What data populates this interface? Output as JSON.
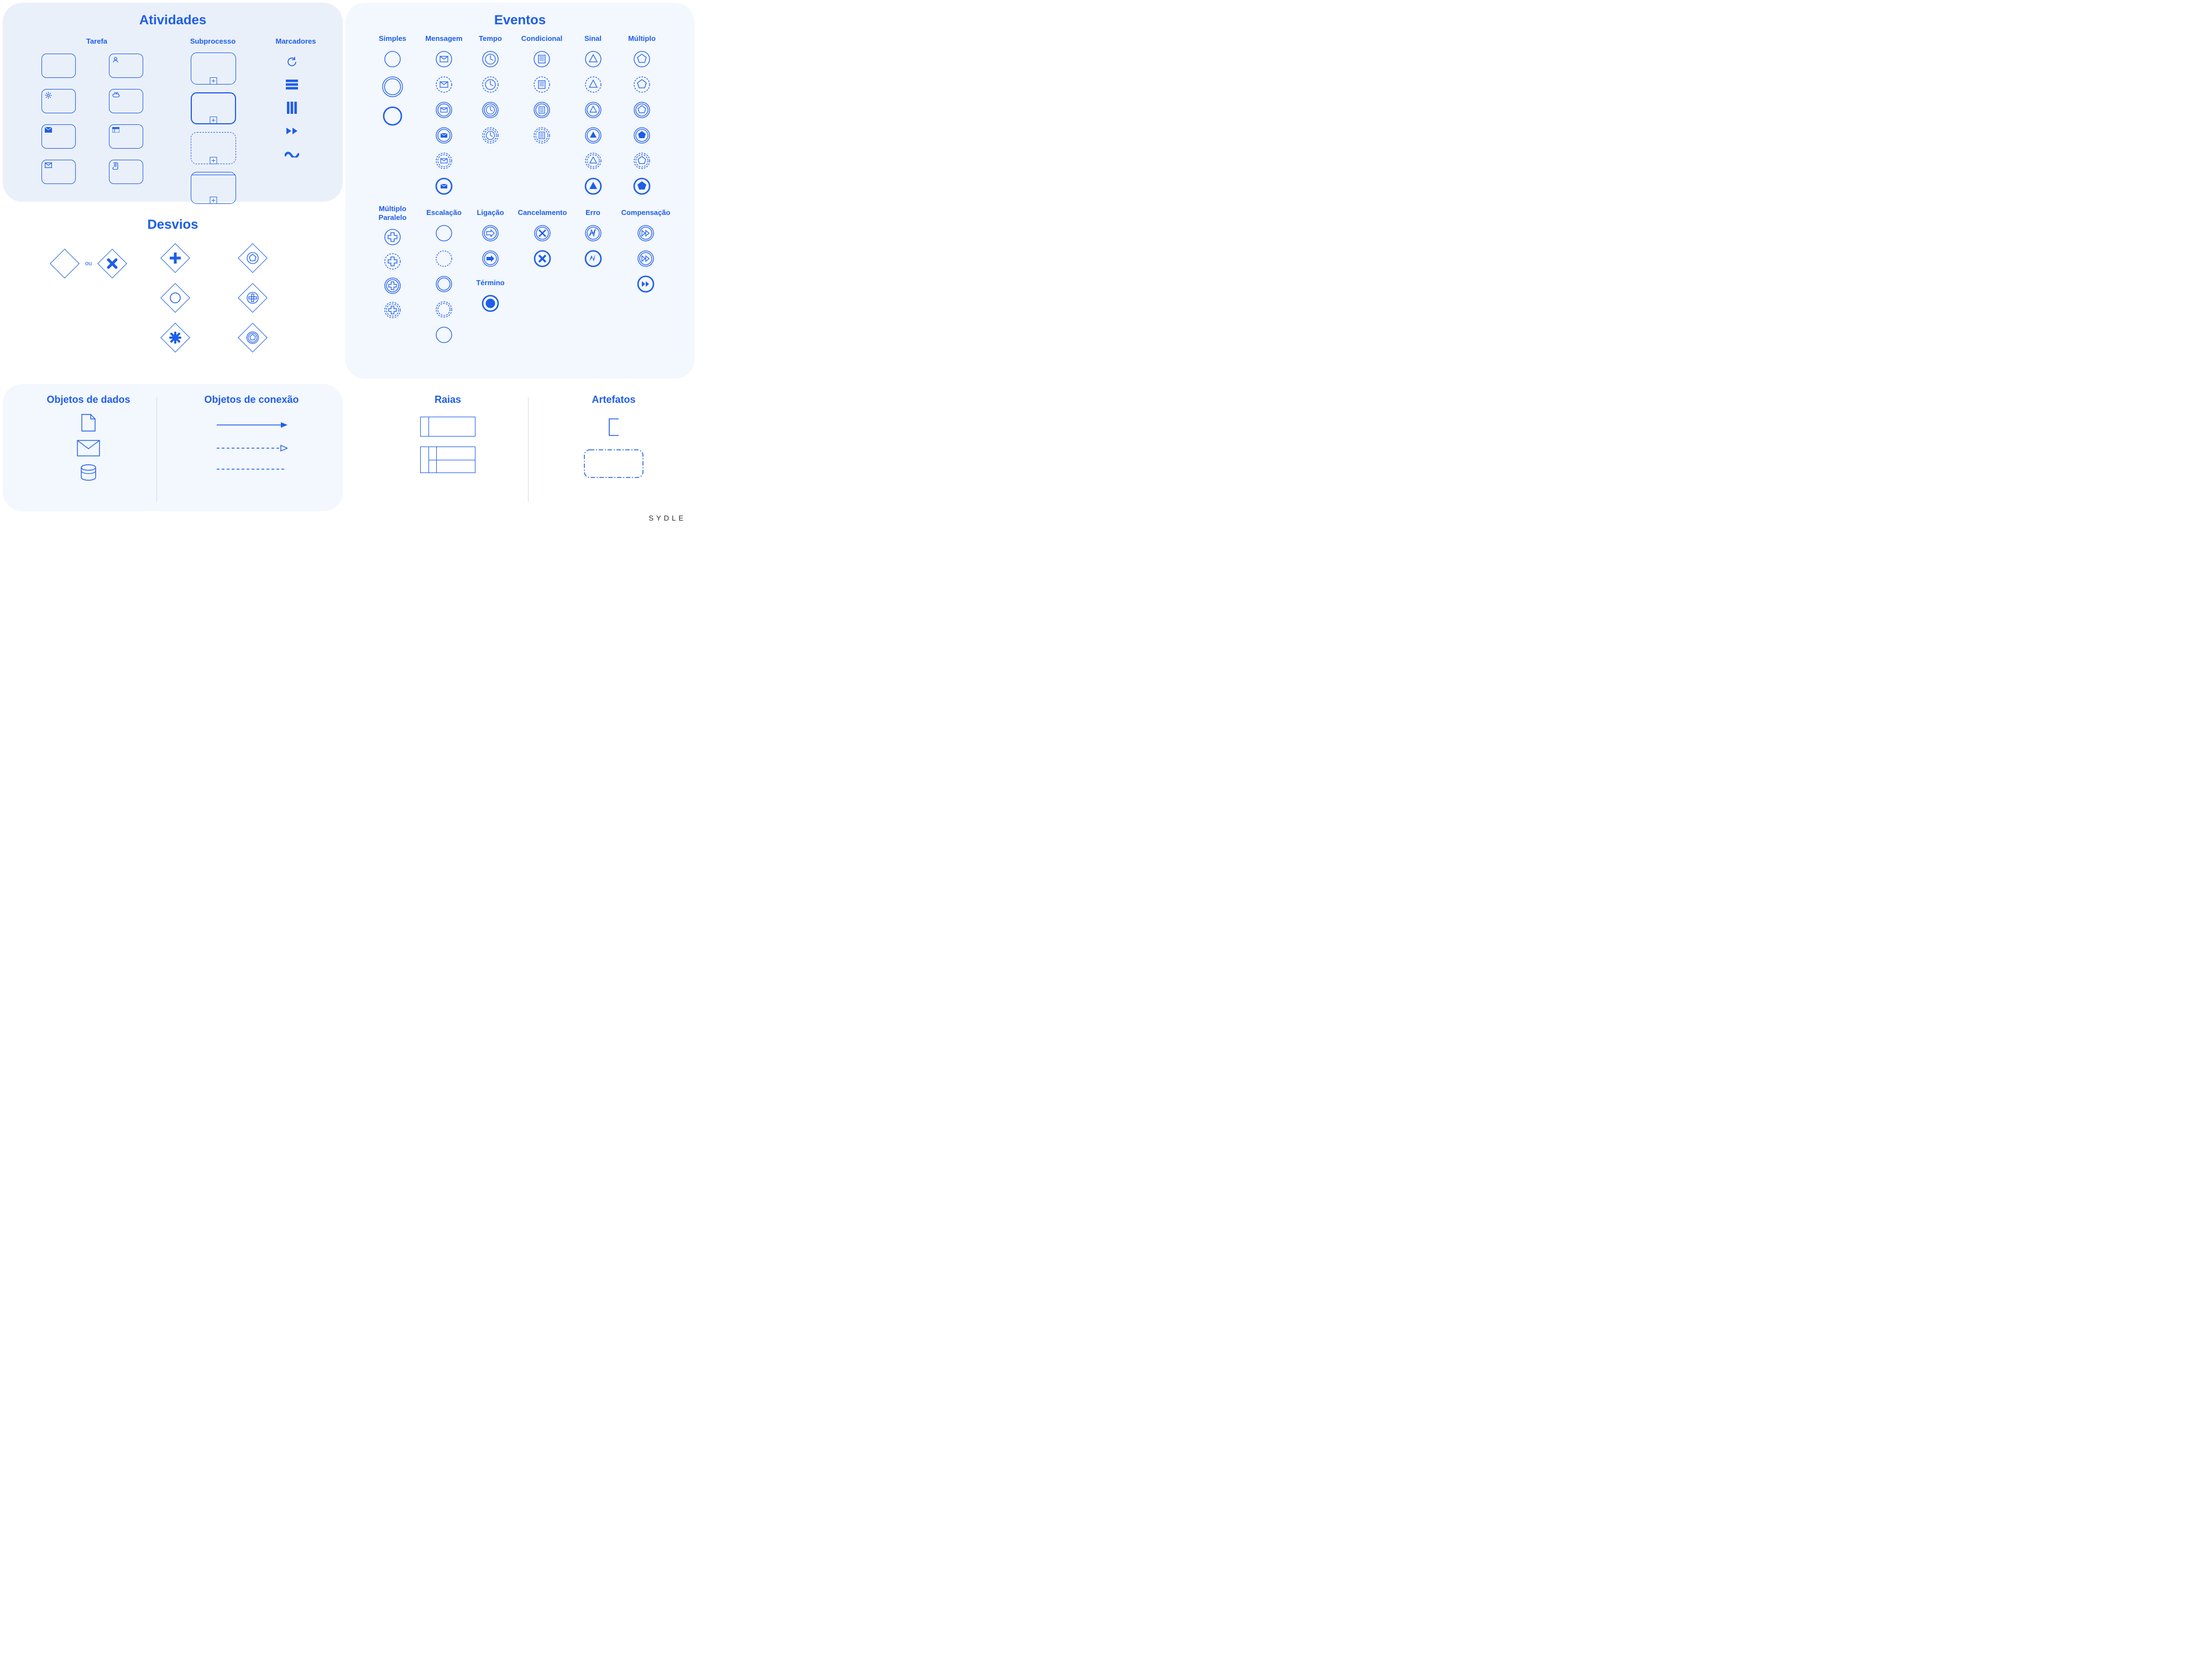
{
  "brand": "SYDLE",
  "atividades": {
    "title": "Atividades",
    "cols": {
      "tarefa": "Tarefa",
      "sub": "Subprocesso",
      "marcadores": "Marcadores"
    }
  },
  "desvios": {
    "title": "Desvios",
    "ou": "ou"
  },
  "eventos": {
    "title": "Eventos",
    "cols": {
      "simples": "Simples",
      "mensagem": "Mensagem",
      "tempo": "Tempo",
      "condicional": "Condicional",
      "sinal": "Sinal",
      "multiplo": "Múltiplo",
      "mp": "Múltiplo\nParalelo",
      "escalacao": "Escalação",
      "ligacao": "Ligação",
      "cancel": "Cancelamento",
      "erro": "Erro",
      "comp": "Compensação"
    },
    "termino": "Término"
  },
  "dados": {
    "title": "Objetos de dados"
  },
  "conexao": {
    "title": "Objetos de conexão"
  },
  "raias": {
    "title": "Raias"
  },
  "artefatos": {
    "title": "Artefatos"
  }
}
